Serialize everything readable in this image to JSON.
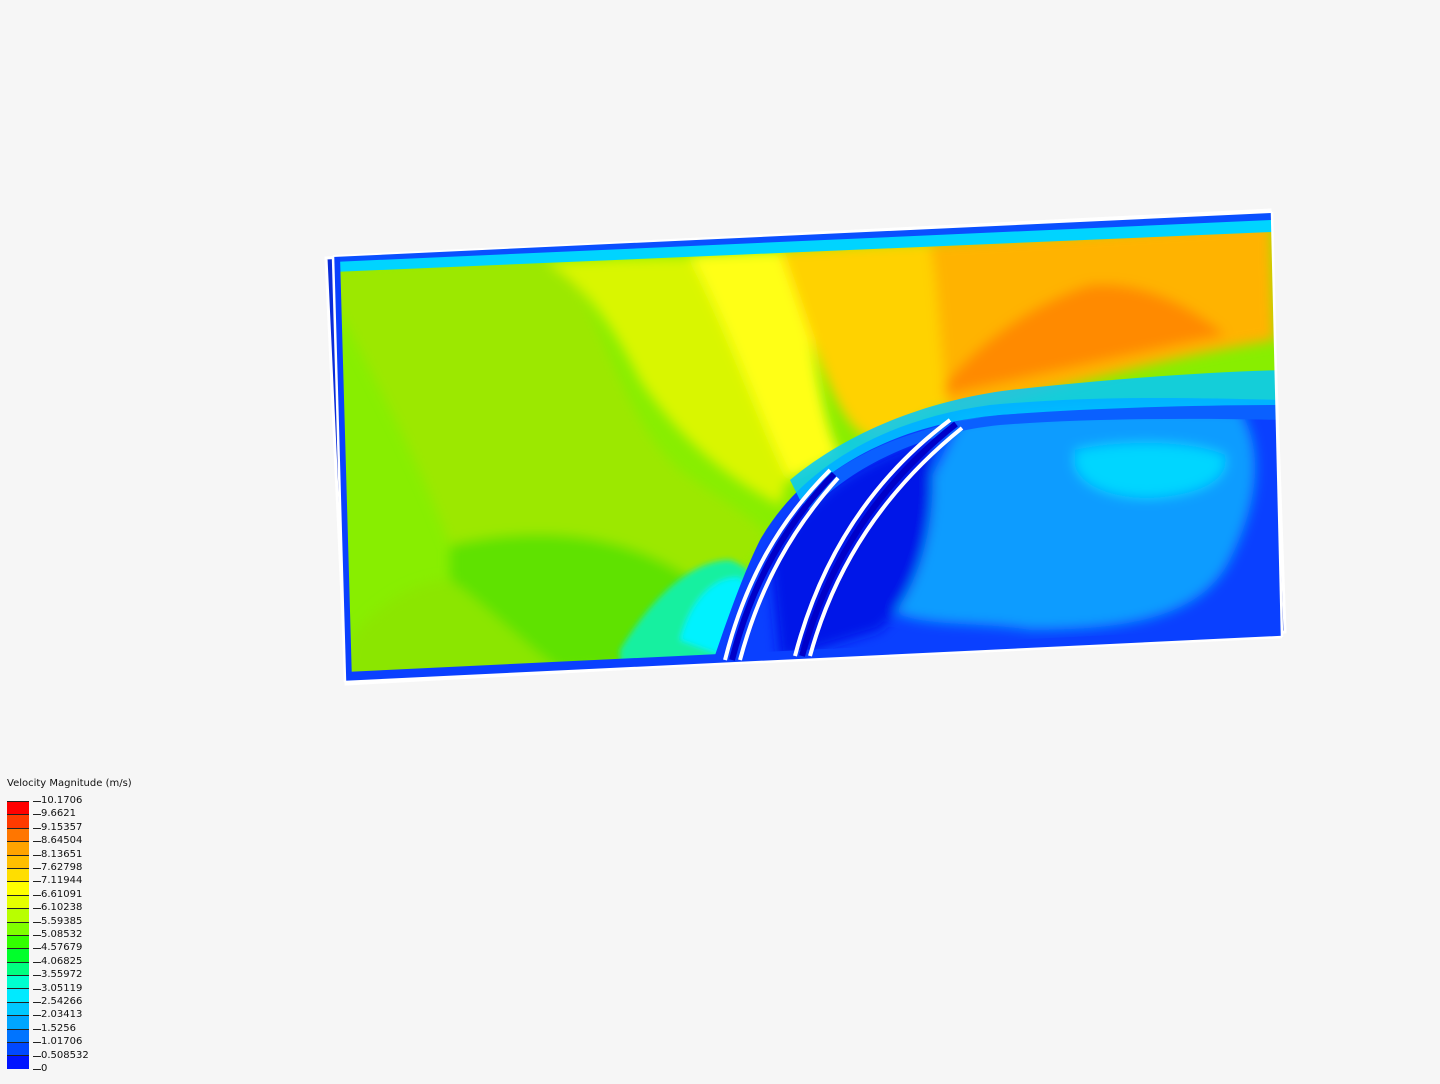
{
  "legend": {
    "title": "Velocity Magnitude (m/s)",
    "levels": [
      {
        "value": "10.1706",
        "color": "#ff0000"
      },
      {
        "value": "9.6621",
        "color": "#ff3a00"
      },
      {
        "value": "9.15357",
        "color": "#ff7600"
      },
      {
        "value": "8.64504",
        "color": "#ffa300"
      },
      {
        "value": "8.13651",
        "color": "#ffbf00"
      },
      {
        "value": "7.62798",
        "color": "#ffde00"
      },
      {
        "value": "7.11944",
        "color": "#ffff00"
      },
      {
        "value": "6.61091",
        "color": "#e5ff00"
      },
      {
        "value": "6.10238",
        "color": "#b8ff00"
      },
      {
        "value": "5.59385",
        "color": "#80ff00"
      },
      {
        "value": "5.08532",
        "color": "#33ff00"
      },
      {
        "value": "4.57679",
        "color": "#00ff2b"
      },
      {
        "value": "4.06825",
        "color": "#00ff80"
      },
      {
        "value": "3.55972",
        "color": "#00ffcf"
      },
      {
        "value": "3.05119",
        "color": "#00eaff"
      },
      {
        "value": "2.54266",
        "color": "#00c8ff"
      },
      {
        "value": "2.03413",
        "color": "#00a6ff"
      },
      {
        "value": "1.5256",
        "color": "#0074ff"
      },
      {
        "value": "1.01706",
        "color": "#0048ff"
      },
      {
        "value": "0.508532",
        "color": "#0014ff"
      },
      {
        "value": "0",
        "color": "#0000e0"
      }
    ]
  }
}
